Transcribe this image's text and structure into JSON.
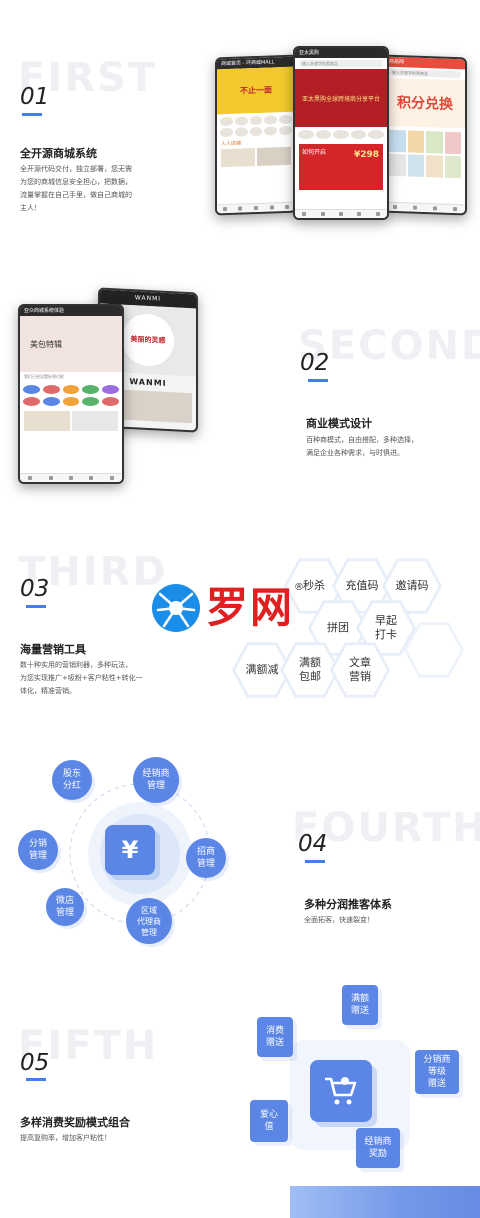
{
  "sections": [
    {
      "ghost": "FIRST",
      "num": "01",
      "title": "全开源商城系统",
      "desc": [
        "全开源代码交付，独立部署，您无需",
        "为您的商城信息安全担心，把数据，",
        "流量掌握在自己手里，做自己商城的",
        "主人！"
      ]
    },
    {
      "ghost": "SECOND",
      "num": "02",
      "title": "商业模式设计",
      "desc": [
        "百种商模式，自由搭配，多种选择，",
        "满足企业各种需求，与时俱进。"
      ]
    },
    {
      "ghost": "THIRD",
      "num": "03",
      "title": "海量营销工具",
      "desc": [
        "数十种实用的营销利器，多种玩法，",
        "为您实现推广+吸粉+客户粘性+转化一",
        "体化，精准营销。"
      ]
    },
    {
      "ghost": "FOURTH",
      "num": "04",
      "title": "多种分润推客体系",
      "desc": [
        "全面拓客，快速裂变！"
      ]
    },
    {
      "ghost": "FIFTH",
      "num": "05",
      "title": "多样消费奖励模式组合",
      "desc": [
        "提高复购率，增加客户粘性！"
      ]
    }
  ],
  "watermark": {
    "text": "罗网",
    "reg": "®"
  },
  "phones1": {
    "left": {
      "bar": "商城首页 - 环商城MALL",
      "banner": "不止一面",
      "label": "人人店铺"
    },
    "mid": {
      "bar": "亚太黑购",
      "search": "输入关键字检索商品",
      "banner": "亚太黑购全球跨境商分享平台",
      "price": "¥298",
      "promo": "如何开启"
    },
    "right": {
      "bar": "商品网",
      "search": "输入关键字检索商品",
      "banner": "积分兑换"
    }
  },
  "phones2": {
    "front": {
      "bar": "亚众商城系统体验",
      "banner": "美包特辑",
      "notice": "我们已经设置好预付款"
    },
    "back": {
      "logo": "WANMI",
      "banner": "美丽的灵感",
      "logo2": "WANMI"
    }
  },
  "hexes": [
    "秒杀",
    "充值码",
    "邀请码",
    "拼团",
    "早起\n打卡",
    "满额减",
    "满额\n包邮",
    "文章\n营销"
  ],
  "bubbles": [
    "股东\n分红",
    "经销商\n管理",
    "分销\n管理",
    "招商\n管理",
    "微店\n管理",
    "区域\n代理商\n管理"
  ],
  "center_icon": "yen-icon",
  "cards": [
    "满额\n赠送",
    "消费\n赠送",
    "分销商\n等级\n赠送",
    "爱心\n值",
    "经销商\n奖励"
  ],
  "cart_icon": "cart-icon",
  "colors": {
    "accent": "#3f7ff0",
    "bubble": "#5b86e5",
    "ghost": "#eef0f4"
  }
}
